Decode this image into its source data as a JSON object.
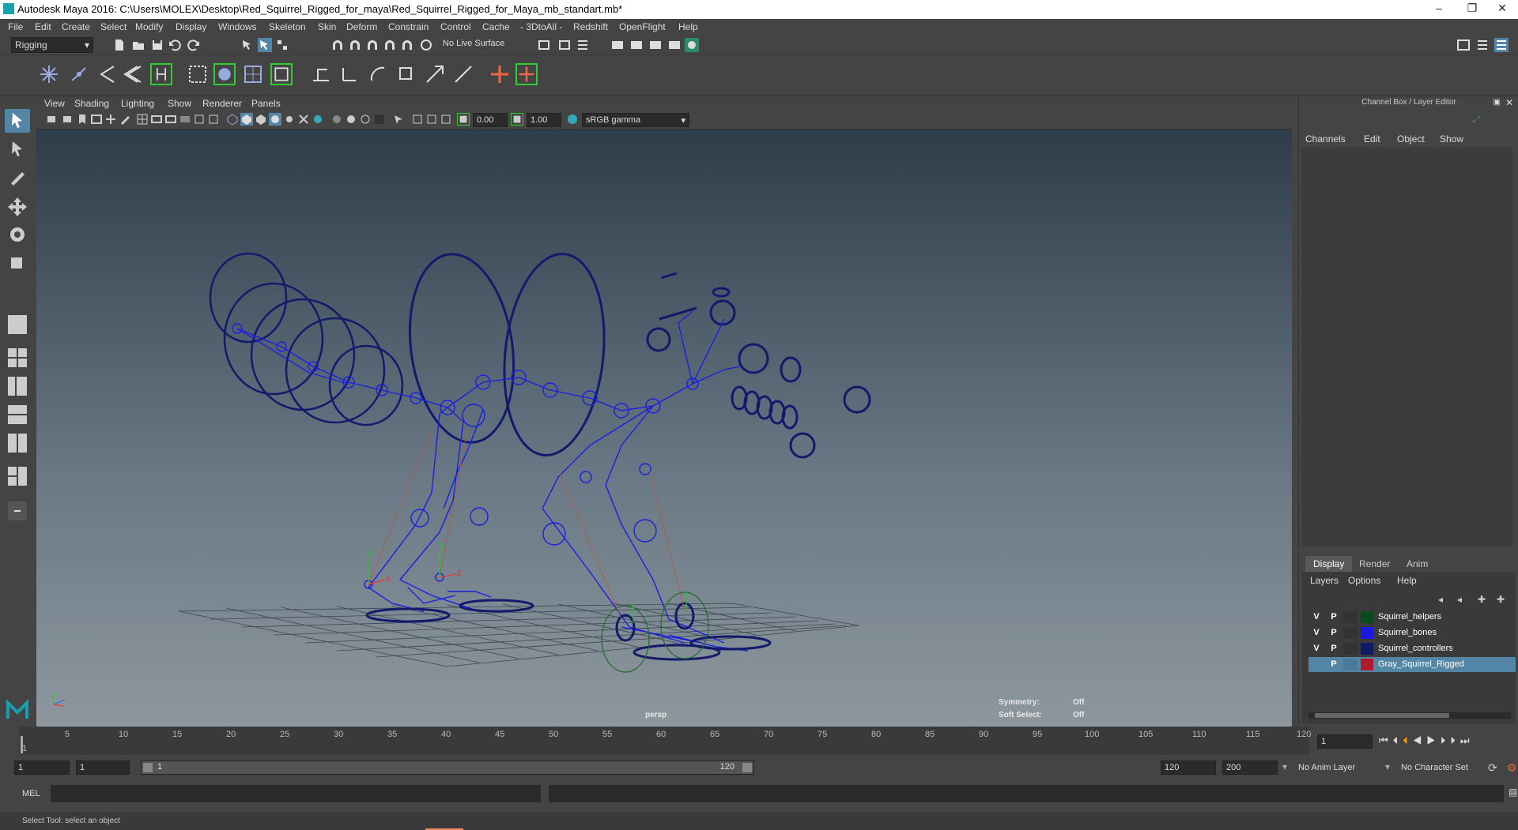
{
  "window": {
    "title": "Autodesk Maya 2016: C:\\Users\\MOLEX\\Desktop\\Red_Squirrel_Rigged_for_maya\\Red_Squirrel_Rigged_for_Maya_mb_standart.mb*",
    "controls": [
      "–",
      "❐",
      "✕"
    ]
  },
  "menubar": [
    "File",
    "Edit",
    "Create",
    "Select",
    "Modify",
    "Display",
    "Windows",
    "Skeleton",
    "Skin",
    "Deform",
    "Constrain",
    "Control",
    "Cache",
    "- 3DtoAll -",
    "Redshift",
    "OpenFlight",
    "Help"
  ],
  "statusline": {
    "menuset": "Rigging",
    "live_surface": "No Live Surface"
  },
  "viewport": {
    "menu": [
      "View",
      "Shading",
      "Lighting",
      "Show",
      "Renderer",
      "Panels"
    ],
    "exposure": "0.00",
    "gamma": "1.00",
    "colorspace": "sRGB gamma",
    "camera_label": "persp",
    "hud": {
      "symmetry_label": "Symmetry:",
      "symmetry_value": "Off",
      "soft_select_label": "Soft Select:",
      "soft_select_value": "Off"
    },
    "axis_y": "y",
    "axis_z": "z"
  },
  "channelbox": {
    "title": "Channel Box / Layer Editor",
    "tabs": [
      "Channels",
      "Edit",
      "Object",
      "Show"
    ]
  },
  "layer_editor": {
    "tabs": [
      "Display",
      "Render",
      "Anim"
    ],
    "menu": [
      "Layers",
      "Options",
      "Help"
    ],
    "layers": [
      {
        "v": "V",
        "p": "P",
        "name": "Squirrel_helpers",
        "color": "#0b4a1a",
        "selected": false
      },
      {
        "v": "V",
        "p": "P",
        "name": "Squirrel_bones",
        "color": "#1a1ae0",
        "selected": false
      },
      {
        "v": "V",
        "p": "P",
        "name": "Squirrel_controllers",
        "color": "#101a66",
        "selected": false
      },
      {
        "v": "",
        "p": "P",
        "name": "Gray_Squirrel_Rigged",
        "color": "#b01a2a",
        "selected": true
      }
    ]
  },
  "timeslider": {
    "ticks": [
      "1",
      "5",
      "10",
      "15",
      "20",
      "25",
      "30",
      "35",
      "40",
      "45",
      "50",
      "55",
      "60",
      "65",
      "70",
      "75",
      "80",
      "85",
      "90",
      "95",
      "100",
      "105",
      "110",
      "115",
      "120"
    ],
    "current_frame": "1"
  },
  "rangeslider": {
    "start": "1",
    "playback_start": "1",
    "range_left": "1",
    "range_right": "120",
    "playback_end": "120",
    "end": "200",
    "anim_layer": "No Anim Layer",
    "character_set": "No Character Set"
  },
  "cmdline": {
    "label": "MEL"
  },
  "helpline": {
    "text": "Select Tool: select an object"
  }
}
